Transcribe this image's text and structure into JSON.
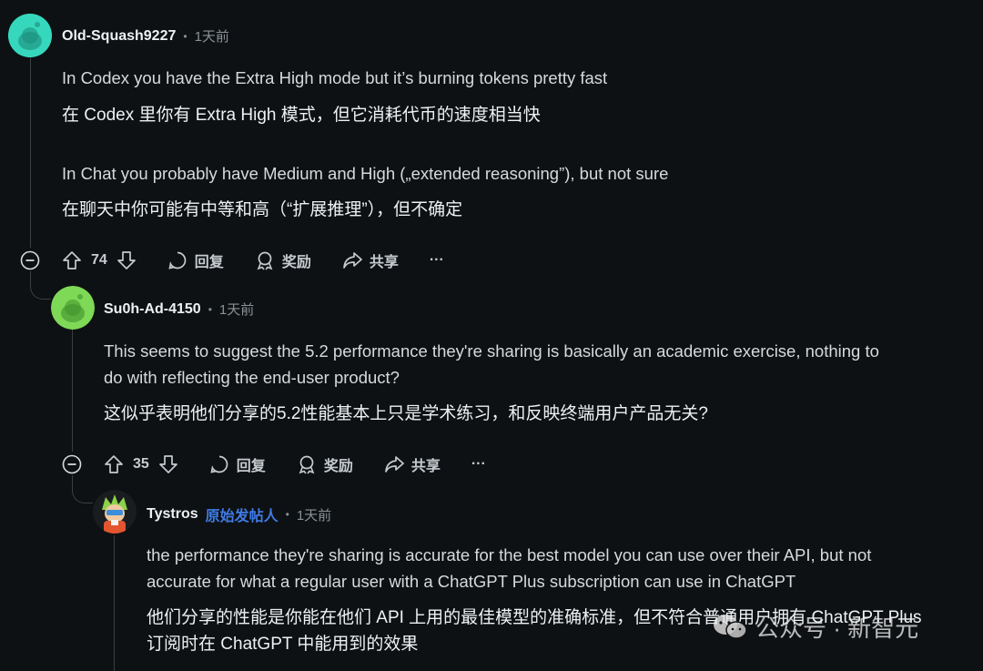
{
  "comments": [
    {
      "username": "Old-Squash9227",
      "time": "1天前",
      "paragraphs": [
        {
          "en": "In Codex you have the Extra High mode but it’s burning tokens pretty fast",
          "zh": "在 Codex 里你有 Extra High 模式，但它消耗代币的速度相当快"
        },
        {
          "en": "In Chat you probably have Medium and High („extended reasoning”), but not sure",
          "zh": "在聊天中你可能有中等和高（“扩展推理”），但不确定"
        }
      ],
      "votes": "74"
    },
    {
      "username": "Su0h-Ad-4150",
      "time": "1天前",
      "paragraphs": [
        {
          "en_lines": [
            "This seems to suggest the 5.2 performance they're sharing is basically an academic exercise, nothing to",
            "do with reflecting the end-user product?"
          ],
          "zh": "这似乎表明他们分享的5.2性能基本上只是学术练习，和反映终端用户产品无关?"
        }
      ],
      "votes": "35"
    },
    {
      "username": "Tystros",
      "op_tag": "原始发帖人",
      "time": "1天前",
      "paragraphs": [
        {
          "en_lines": [
            "the performance they're sharing is accurate for the best model you can use over their API, but not",
            "accurate for what a regular user with a ChatGPT Plus subscription can use in ChatGPT"
          ],
          "zh_lines": [
            "他们分享的性能是你能在他们 API 上用的最佳模型的准确标准，但不符合普通用户拥有 ChatGPT Plus",
            "订阅时在 ChatGPT 中能用到的效果"
          ]
        }
      ]
    }
  ],
  "actions": {
    "reply": "回复",
    "award": "奖励",
    "share": "共享",
    "more": "···"
  },
  "separator": "•",
  "watermark": "公众号 · 新智元",
  "icons": [
    "collapse-icon",
    "upvote-icon",
    "downvote-icon",
    "reply-icon",
    "award-icon",
    "share-icon",
    "more-icon",
    "wechat-icon"
  ],
  "colors": {
    "background": "#0e1113",
    "op_tag": "#3f7be6",
    "text": "#d7dadc",
    "muted": "#8a9196"
  }
}
